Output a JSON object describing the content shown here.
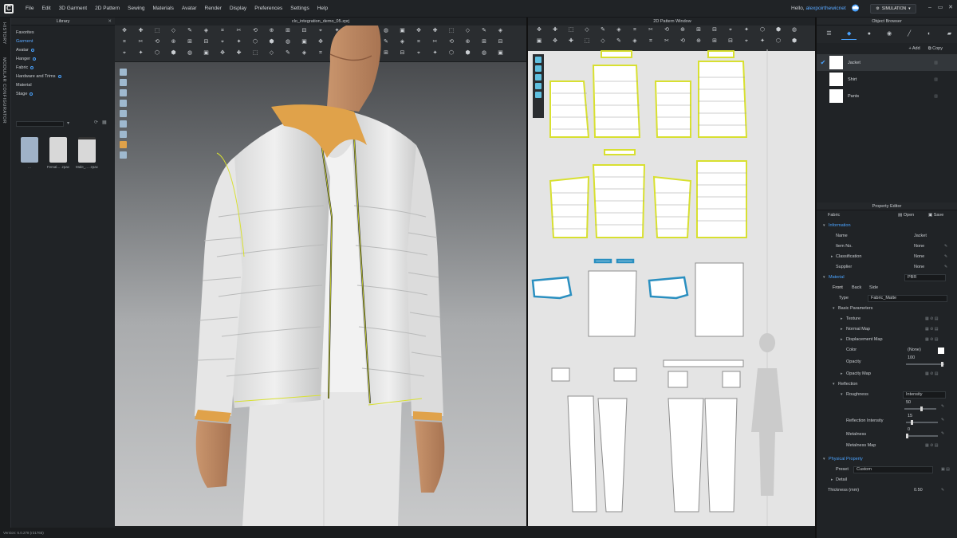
{
  "menu": {
    "logo": "C",
    "items": [
      "File",
      "Edit",
      "3D Garment",
      "2D Pattern",
      "Sewing",
      "Materials",
      "Avatar",
      "Render",
      "Display",
      "Preferences",
      "Settings",
      "Help"
    ],
    "hello_prefix": "Hello,",
    "user": "alexpoirthewicnet",
    "simulation_label": "SIMULATION",
    "window_controls": [
      "–",
      "▭",
      "✕"
    ]
  },
  "vertical_tabs": [
    "HISTORY",
    "MODULAR CONFIGURATOR"
  ],
  "library": {
    "title": "Library",
    "items": [
      "Favorites",
      "Garment",
      "Avatar",
      "Hanger",
      "Fabric",
      "Hardware and Trims",
      "Material",
      "Stage"
    ],
    "active_item": "Garment",
    "thumbnails": [
      "...",
      "Femal... .zpac",
      "Male_... .zpac"
    ]
  },
  "view3d": {
    "title": "clo_integration_demo_05.zprj"
  },
  "view2d": {
    "title": "2D Pattern Window"
  },
  "object_browser": {
    "title": "Object Browser",
    "add_label": "Add",
    "copy_label": "Copy",
    "items": [
      {
        "label": "Jacket",
        "selected": true
      },
      {
        "label": "Shirt",
        "selected": false
      },
      {
        "label": "Pants",
        "selected": false
      }
    ]
  },
  "property_editor": {
    "title": "Property Editor",
    "type_label": "Fabric",
    "open_label": "Open",
    "save_label": "Save",
    "information": "Information",
    "name_k": "Name",
    "name_v": "Jacket",
    "item_k": "Item No.",
    "item_v": "None",
    "class_k": "Classification",
    "class_v": "None",
    "supplier_k": "Supplier",
    "supplier_v": "None",
    "material": "Material",
    "material_v": "PBR",
    "sides": [
      "Front",
      "Back",
      "Side"
    ],
    "type_k": "Type",
    "type_v": "Fabric_Matte",
    "basic": "Basic Parameters",
    "texture": "Texture",
    "normal_map": "Normal Map",
    "disp_map": "Displacement Map",
    "color_k": "Color",
    "color_v": "(None)",
    "opacity_k": "Opacity",
    "opacity_v": "100",
    "opacity_map": "Opacity Map",
    "reflection": "Reflection",
    "roughness_k": "Roughness",
    "roughness_v": "Intensity",
    "roughness_num": "50",
    "refl_int_k": "Reflection Intensity",
    "refl_int_v": "15",
    "metalness_k": "Metalness",
    "metalness_v": "0",
    "metalness_map": "Metalness Map",
    "physical": "Physical Property",
    "preset_k": "Preset",
    "preset_v": "Custom",
    "detail": "Detail",
    "thickness_k": "Thickness (mm)",
    "thickness_v": "0.50"
  },
  "status": {
    "version": "Version: 6.0.278 (r31765)"
  },
  "colors": {
    "accent": "#4aa3ff",
    "collar": "#e0a24a",
    "pattern_outline": "#d8e030",
    "blue_piece": "#2a8fc0"
  }
}
